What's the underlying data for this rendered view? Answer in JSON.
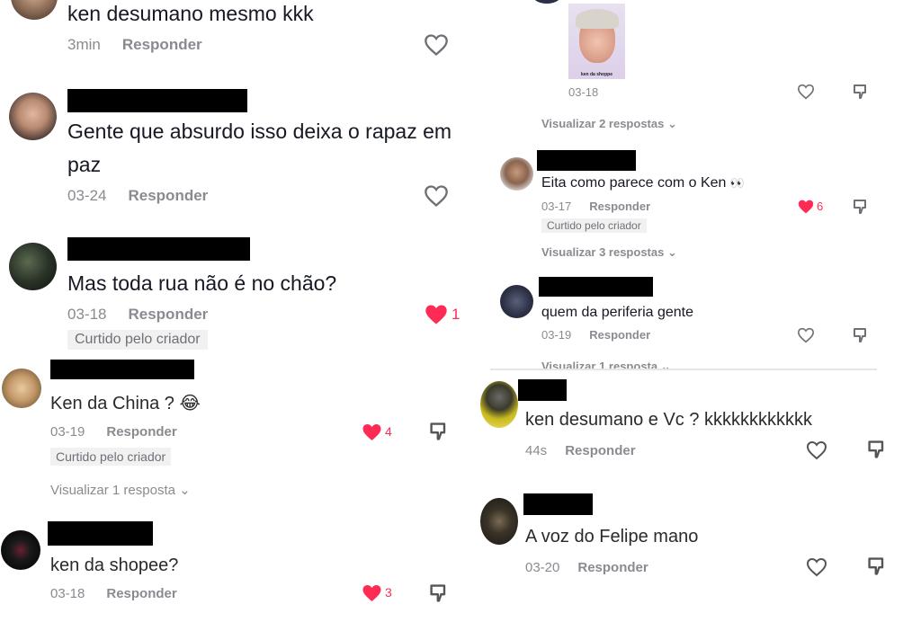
{
  "panel_a": {
    "comments": [
      {
        "text": "ken desumano mesmo kkk",
        "time": "3min",
        "reply": "Responder"
      },
      {
        "text_line1": "Gente que absurdo isso deixa o rapaz em",
        "text_line2": "paz",
        "time": "03-24",
        "reply": "Responder"
      },
      {
        "text": "Mas toda rua não é no chão?",
        "time": "03-18",
        "reply": "Responder",
        "likes": "1",
        "badge": "Curtido pelo criador"
      }
    ]
  },
  "panel_b": {
    "top": {
      "time": "03-18",
      "thumb_caption": "ken da shoppe",
      "view_replies": "Visualizar 2 respostas"
    },
    "comments": [
      {
        "text": "Eita como parece com o Ken",
        "emoji": "👀",
        "time": "03-17",
        "reply": "Responder",
        "likes": "6",
        "badge": "Curtido pelo criador",
        "view_replies": "Visualizar 3 respostas"
      },
      {
        "text": "quem da periferia gente",
        "time": "03-19",
        "reply": "Responder",
        "view_replies": "Visualizar 1 resposta"
      }
    ]
  },
  "panel_c": {
    "comments": [
      {
        "text": "Ken da China ?",
        "emoji": "😂",
        "time": "03-19",
        "reply": "Responder",
        "likes": "4",
        "badge": "Curtido pelo criador",
        "view_replies": "Visualizar 1 resposta"
      },
      {
        "text": "ken da shopee?",
        "time": "03-18",
        "reply": "Responder",
        "likes": "3"
      }
    ]
  },
  "panel_d": {
    "comments": [
      {
        "text": "ken desumano e Vc ? kkkkkkkkkkkk",
        "time": "44s",
        "reply": "Responder"
      },
      {
        "text": "A voz do Felipe mano",
        "time": "03-20",
        "reply": "Responder"
      }
    ]
  },
  "colors": {
    "like_red": "#fe2c55",
    "meta_gray": "#8a8b91",
    "badge_bg": "#f1f1f2"
  }
}
